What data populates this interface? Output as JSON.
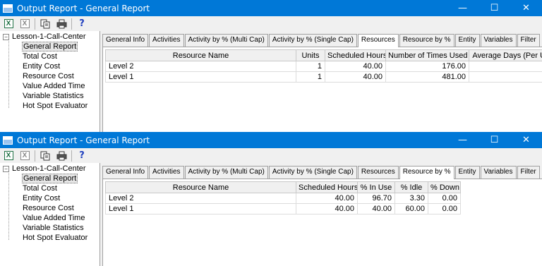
{
  "windows": [
    {
      "title": "Output Report - General Report",
      "tree": {
        "root": "Lesson-1-Call-Center",
        "items": [
          "General Report",
          "Total Cost",
          "Entity Cost",
          "Resource Cost",
          "Value Added Time",
          "Variable Statistics",
          "Hot Spot Evaluator"
        ],
        "selected": "General Report"
      },
      "tabs": [
        "General Info",
        "Activities",
        "Activity by % (Multi Cap)",
        "Activity by % (Single Cap)",
        "Resources",
        "Resource by %",
        "Entity",
        "Variables",
        "Filter"
      ],
      "active_tab": "Resources",
      "columns": [
        "Resource Name",
        "Units",
        "Scheduled Hours",
        "Number of Times Used",
        "Average Days (Per Usa"
      ],
      "rows": [
        [
          "Level 2",
          "1",
          "40.00",
          "176.00",
          ""
        ],
        [
          "Level 1",
          "1",
          "40.00",
          "481.00",
          ""
        ]
      ]
    },
    {
      "title": "Output Report - General Report",
      "tree": {
        "root": "Lesson-1-Call-Center",
        "items": [
          "General Report",
          "Total Cost",
          "Entity Cost",
          "Resource Cost",
          "Value Added Time",
          "Variable Statistics",
          "Hot Spot Evaluator"
        ],
        "selected": "General Report"
      },
      "tabs": [
        "General Info",
        "Activities",
        "Activity by % (Multi Cap)",
        "Activity by % (Single Cap)",
        "Resources",
        "Resource by %",
        "Entity",
        "Variables",
        "Filter"
      ],
      "active_tab": "Resource by %",
      "columns": [
        "Resource Name",
        "Scheduled Hours",
        "% In Use",
        "% Idle",
        "% Down"
      ],
      "rows": [
        [
          "Level 2",
          "40.00",
          "96.70",
          "3.30",
          "0.00"
        ],
        [
          "Level 1",
          "40.00",
          "40.00",
          "60.00",
          "0.00"
        ]
      ]
    }
  ],
  "toolbar": {
    "icons": [
      "excel-export-icon",
      "excel-disabled-icon",
      "copy-icon",
      "print-icon",
      "help-icon"
    ],
    "excel_glyph": "X",
    "help_glyph": "?"
  },
  "window_buttons": {
    "minimize": "—",
    "maximize": "☐",
    "close": "✕"
  },
  "colors": {
    "titlebar": "#0078d7",
    "excel_green": "#1d6f42",
    "help_blue": "#1f3fbf"
  }
}
